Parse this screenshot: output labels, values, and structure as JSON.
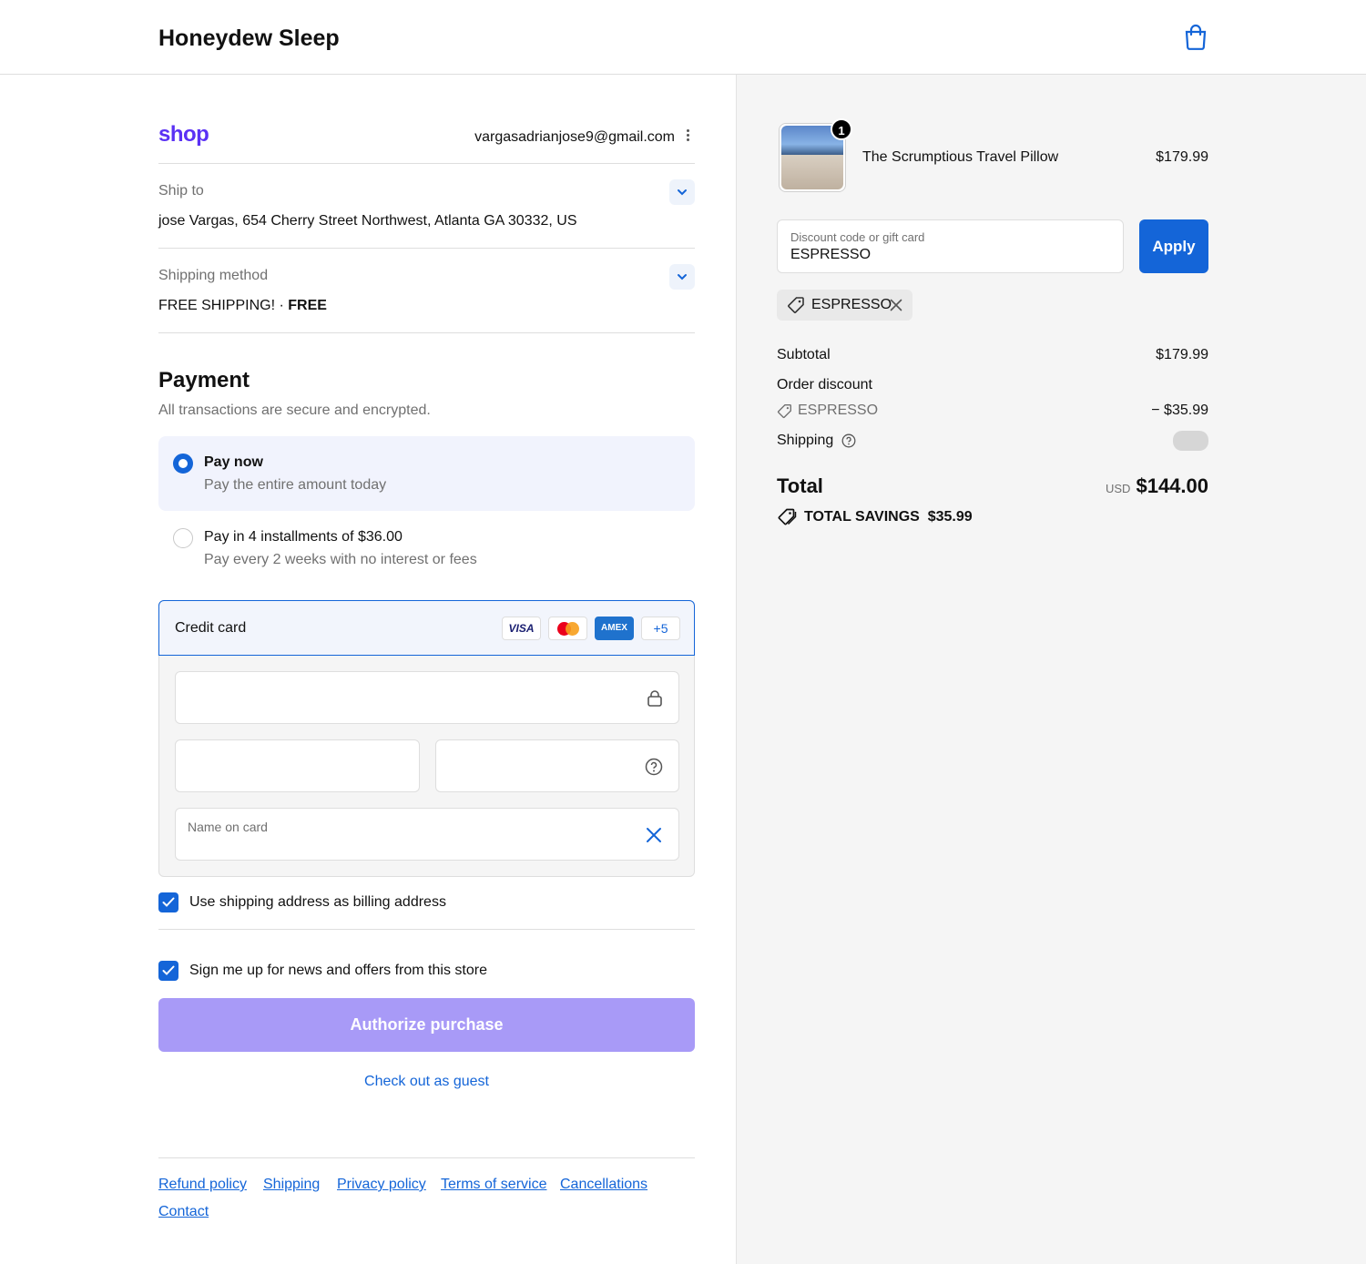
{
  "header": {
    "store_name": "Honeydew Sleep",
    "cart_icon": "shopping-bag-icon"
  },
  "shop_account": {
    "logo_text": "shop",
    "email": "vargasadrianjose9@gmail.com",
    "menu_icon": "kebab-menu-icon"
  },
  "ship_to": {
    "label": "Ship to",
    "value": "jose Vargas, 654 Cherry Street Northwest, Atlanta GA 30332, US"
  },
  "shipping_method": {
    "label": "Shipping method",
    "value": "FREE SHIPPING!",
    "separator": "·",
    "price": "FREE"
  },
  "payment": {
    "title": "Payment",
    "subtitle": "All transactions are secure and encrypted.",
    "options": [
      {
        "title": "Pay now",
        "subtitle": "Pay the entire amount today",
        "selected": true
      },
      {
        "title": "Pay in 4 installments of $36.00",
        "subtitle": "Pay every 2 weeks with no interest or fees",
        "selected": false
      }
    ],
    "credit_card": {
      "label": "Credit card",
      "brands": [
        "VISA",
        "",
        "AMEX"
      ],
      "more": "+5",
      "card_number_value": "",
      "expiration_value": "",
      "security_code_value": "",
      "name_label": "Name on card",
      "name_value": ""
    },
    "billing_checkbox": {
      "label": "Use shipping address as billing address",
      "checked": true
    },
    "newsletter_checkbox": {
      "label": "Sign me up for news and offers from this store",
      "checked": true
    }
  },
  "actions": {
    "authorize": "Authorize purchase",
    "guest": "Check out as guest"
  },
  "footer": {
    "links": [
      "Refund policy",
      "Shipping",
      "Privacy policy",
      "Terms of service",
      "Cancellations",
      "Contact"
    ]
  },
  "order": {
    "item": {
      "name": "The Scrumptious Travel Pillow",
      "price": "$179.99",
      "quantity": "1"
    },
    "discount_input": {
      "placeholder": "Discount code or gift card",
      "value": "ESPRESSO"
    },
    "apply": "Apply",
    "applied_code": "ESPRESSO",
    "subtotal": {
      "label": "Subtotal",
      "value": "$179.99"
    },
    "order_discount": {
      "label": "Order discount",
      "code": "ESPRESSO",
      "value": "− $35.99"
    },
    "shipping": {
      "label": "Shipping"
    },
    "total": {
      "label": "Total",
      "currency": "USD",
      "value": "$144.00"
    },
    "savings": {
      "label": "TOTAL SAVINGS",
      "value": "$35.99"
    }
  },
  "colors": {
    "accent": "#1465d8",
    "shop_purple": "#5a31f4",
    "authorize_button": "#a89af7",
    "summary_bg": "#f5f5f5"
  }
}
